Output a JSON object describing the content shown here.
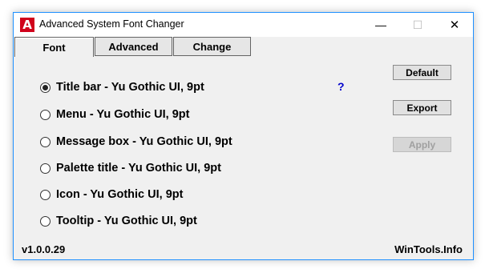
{
  "window": {
    "title": "Advanced System Font Changer",
    "app_icon_glyph": "A",
    "accent_color": "#1e90ff",
    "icon_color": "#d0021b",
    "controls": {
      "minimize": "—",
      "maximize": "☐",
      "close": "✕"
    }
  },
  "tabs": [
    {
      "label": "Font",
      "selected": true
    },
    {
      "label": "Advanced",
      "selected": false
    },
    {
      "label": "Change",
      "selected": false
    }
  ],
  "font_items": [
    {
      "label": "Title bar - Yu Gothic UI, 9pt",
      "selected": true
    },
    {
      "label": "Menu - Yu Gothic UI, 9pt",
      "selected": false
    },
    {
      "label": "Message box - Yu Gothic UI, 9pt",
      "selected": false
    },
    {
      "label": "Palette title - Yu Gothic UI, 9pt",
      "selected": false
    },
    {
      "label": "Icon - Yu Gothic UI, 9pt",
      "selected": false
    },
    {
      "label": "Tooltip - Yu Gothic UI, 9pt",
      "selected": false
    }
  ],
  "help_label": "?",
  "buttons": {
    "default": "Default",
    "export": "Export",
    "apply": "Apply",
    "apply_enabled": false
  },
  "footer": {
    "version": "v1.0.0.29",
    "site": "WinTools.Info"
  }
}
